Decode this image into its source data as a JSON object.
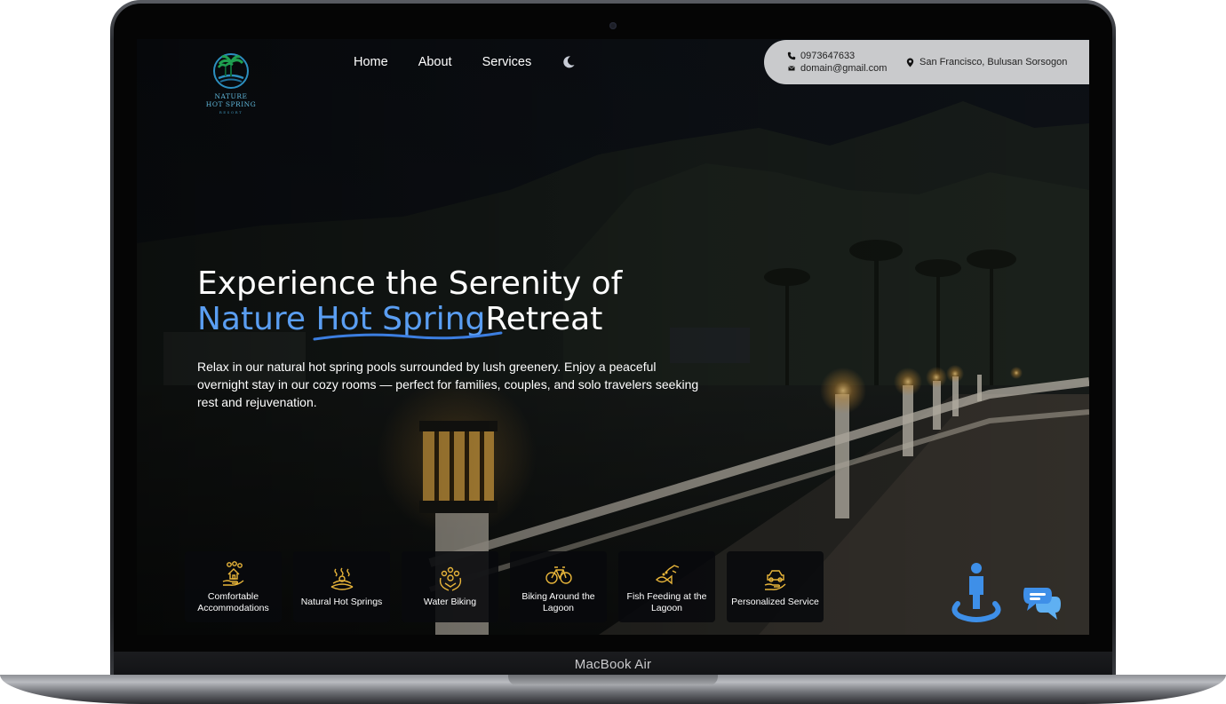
{
  "device": {
    "label": "MacBook Air"
  },
  "site": {
    "logo": {
      "line1": "NATURE",
      "line2": "HOT SPRING",
      "line3": "RESORT"
    },
    "nav": {
      "home": "Home",
      "about": "About",
      "services": "Services"
    },
    "contact": {
      "phone": "0973647633",
      "email": "domain@gmail.com",
      "location": "San Francisco, Bulusan Sorsogon"
    },
    "hero": {
      "title_line1": "Experience the Serenity of",
      "title_word1": "Nature ",
      "title_word2": "Hot Spring",
      "title_word3": "Retreat",
      "description": "Relax in our natural hot spring pools surrounded by lush greenery. Enjoy a peaceful overnight stay in our cozy rooms — perfect for families, couples, and solo travelers seeking rest and rejuvenation."
    },
    "features": [
      {
        "label": "Comfortable Accommodations",
        "icon": "house-hand-icon"
      },
      {
        "label": "Natural Hot Springs",
        "icon": "hot-spring-icon"
      },
      {
        "label": "Water Biking",
        "icon": "water-biking-icon"
      },
      {
        "label": "Biking Around the Lagoon",
        "icon": "bicycle-icon"
      },
      {
        "label": "Fish Feeding at the Lagoon",
        "icon": "fish-feeding-icon"
      },
      {
        "label": "Personalized Service",
        "icon": "car-hand-icon"
      }
    ],
    "colors": {
      "accent": "#5a9ef2",
      "icon_gold": "#e8b53a",
      "widget_blue": "#3e8fe8"
    }
  }
}
